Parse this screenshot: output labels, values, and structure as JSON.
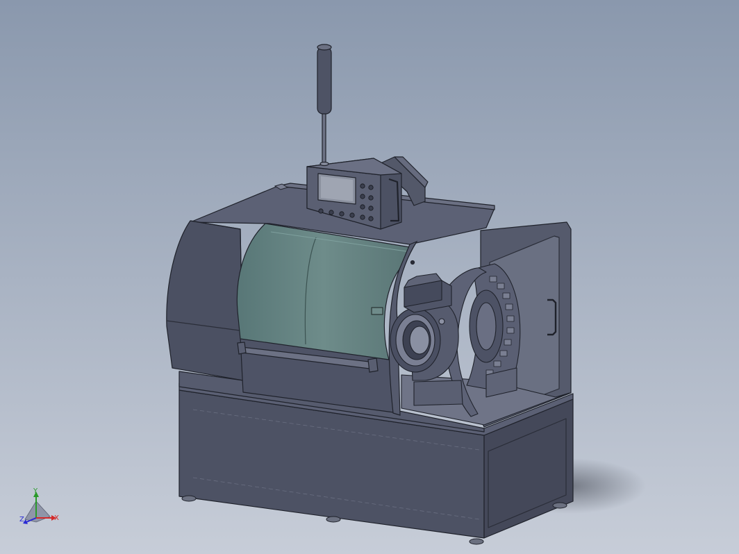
{
  "model": {
    "description_hidden": "",
    "colors": {
      "background_top": "#8e9cb0",
      "background_bottom": "#c4cbd7",
      "body": "#4c5163",
      "body_dark": "#3a3e4d",
      "body_light": "#5e6377",
      "edge": "#1f222b",
      "glass": "#5f7f80",
      "glass_light": "#7a9796"
    }
  },
  "triad": {
    "x_label": "X",
    "y_label": "Y",
    "z_label": "Z",
    "x_color": "#d42a2a",
    "y_color": "#2a9a2a",
    "z_color": "#2a2ad4"
  }
}
